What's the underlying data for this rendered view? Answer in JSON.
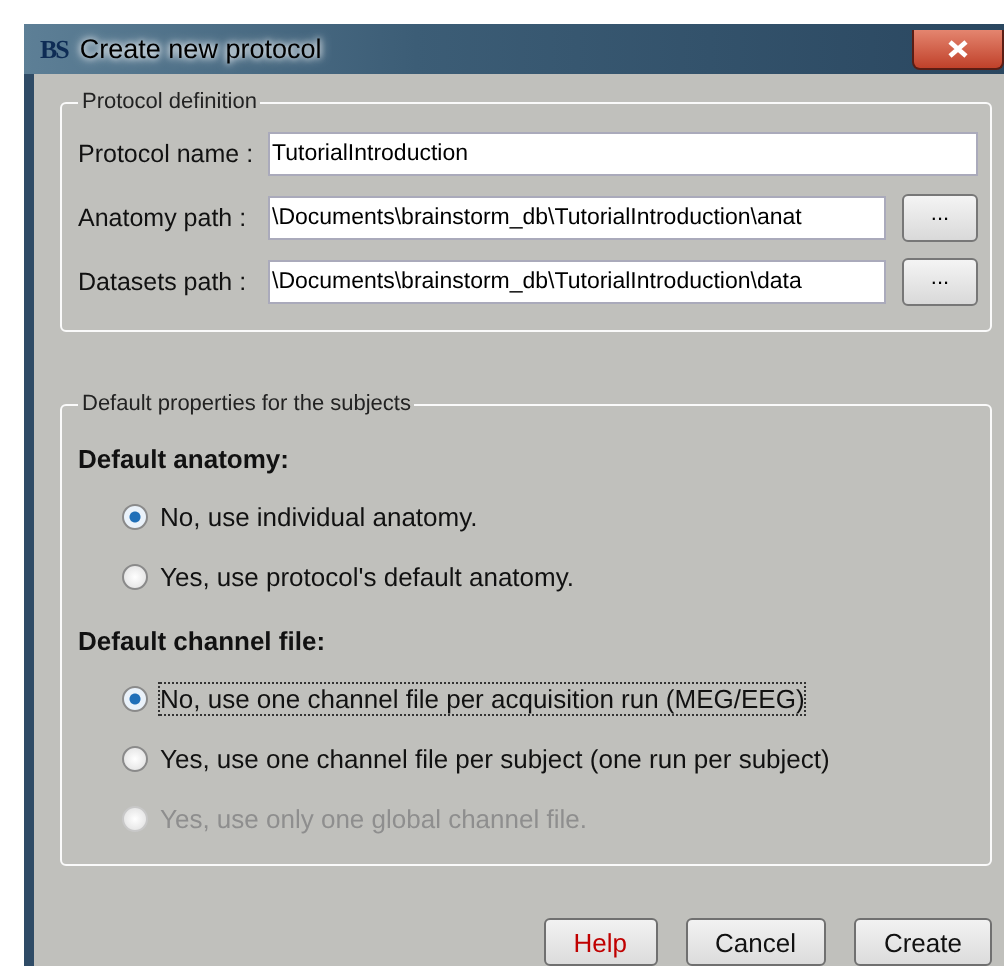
{
  "window": {
    "title": "Create new protocol",
    "icon": "BS"
  },
  "protocol_definition": {
    "legend": "Protocol definition",
    "fields": [
      {
        "label": "Protocol name :",
        "value": "TutorialIntroduction"
      },
      {
        "label": "Anatomy path :",
        "value": "\\Documents\\brainstorm_db\\TutorialIntroduction\\anat",
        "browse": "..."
      },
      {
        "label": "Datasets path :",
        "value": "\\Documents\\brainstorm_db\\TutorialIntroduction\\data",
        "browse": "..."
      }
    ]
  },
  "default_properties": {
    "legend": "Default properties for the subjects",
    "sections": [
      {
        "heading": "Default anatomy:",
        "options": [
          {
            "label": "No, use individual anatomy.",
            "selected": true,
            "disabled": false,
            "focused": false
          },
          {
            "label": "Yes, use protocol's default anatomy.",
            "selected": false,
            "disabled": false,
            "focused": false
          }
        ]
      },
      {
        "heading": "Default channel file:",
        "options": [
          {
            "label": "No, use one channel file per acquisition run (MEG/EEG)",
            "selected": true,
            "disabled": false,
            "focused": true
          },
          {
            "label": "Yes, use one channel file per subject  (one run per subject)",
            "selected": false,
            "disabled": false,
            "focused": false
          },
          {
            "label": "Yes, use only one global channel file.",
            "selected": false,
            "disabled": true,
            "focused": false
          }
        ]
      }
    ]
  },
  "buttons": [
    {
      "label": "Help",
      "kind": "help"
    },
    {
      "label": "Cancel",
      "kind": "normal"
    },
    {
      "label": "Create",
      "kind": "normal"
    }
  ]
}
